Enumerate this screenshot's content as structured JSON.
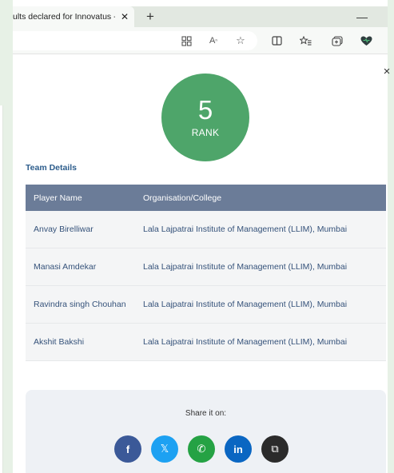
{
  "browser": {
    "tab_title": "ults declared for Innovatus -  ",
    "tab_close": "✕",
    "new_tab": "+",
    "minimize": "—"
  },
  "toolbar_icons": [
    "grid-apps-icon",
    "read-aloud-icon",
    "favorite-star-icon",
    "split-screen-icon",
    "favorites-list-icon",
    "collections-icon",
    "browser-essentials-icon"
  ],
  "page": {
    "close": "×",
    "rank": {
      "value": "5",
      "label": "RANK"
    },
    "team_heading": "Team Details",
    "table": {
      "headers": [
        "Player Name",
        "Organisation/College"
      ],
      "rows": [
        [
          "Anvay Birelliwar",
          "Lala Lajpatrai Institute of Management (LLIM), Mumbai"
        ],
        [
          "Manasi Amdekar",
          "Lala Lajpatrai Institute of Management (LLIM), Mumbai"
        ],
        [
          "Ravindra singh Chouhan",
          "Lala Lajpatrai Institute of Management (LLIM), Mumbai"
        ],
        [
          "Akshit Bakshi",
          "Lala Lajpatrai Institute of Management (LLIM), Mumbai"
        ]
      ]
    },
    "share": {
      "title": "Share it on:",
      "buttons": [
        {
          "name": "facebook",
          "glyph": "f",
          "color": "#3b5998"
        },
        {
          "name": "x",
          "glyph": "𝕏",
          "color": "#1da1f2"
        },
        {
          "name": "whatsapp",
          "glyph": "✆",
          "color": "#25a244"
        },
        {
          "name": "linkedin",
          "glyph": "in",
          "color": "#0a66c2"
        },
        {
          "name": "copy",
          "glyph": "⧉",
          "color": "#2b2b2b"
        }
      ]
    }
  },
  "colors": {
    "rank_circle": "#4ea56a",
    "table_header": "#6b7c98",
    "accent_text": "#2d5d8c"
  }
}
